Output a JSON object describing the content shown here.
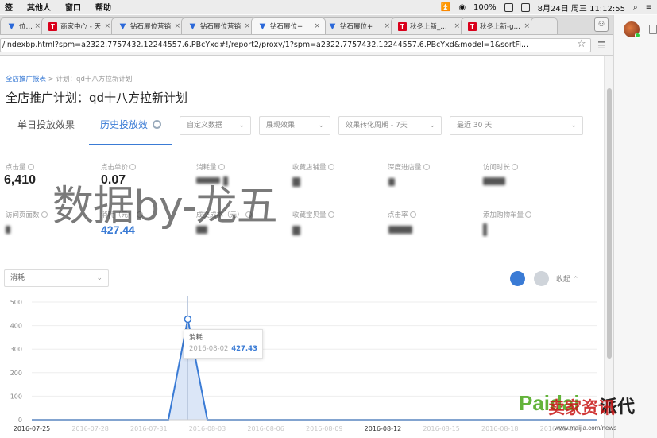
{
  "menubar": {
    "items": [
      "签",
      "其他人",
      "窗口",
      "帮助"
    ],
    "battery": "100%",
    "datetime": "8月24日 周三  11:12:55"
  },
  "browser": {
    "tabs": [
      {
        "label": "位营销",
        "icon": "diamond-icon"
      },
      {
        "label": "商家中心 - 天",
        "icon": "tmall-icon"
      },
      {
        "label": "钻石展位营销",
        "icon": "diamond-icon"
      },
      {
        "label": "钻石展位营销",
        "icon": "diamond-icon"
      },
      {
        "label": "钻石展位+",
        "icon": "diamond-icon",
        "active": true
      },
      {
        "label": "钻石展位+",
        "icon": "diamond-icon"
      },
      {
        "label": "秋冬上新_下拉",
        "icon": "tmall-icon"
      },
      {
        "label": "秋冬上新-girls",
        "icon": "tmall-icon"
      }
    ],
    "url": "/indexbp.html?spm=a2322.7757432.12244557.6.PBcYxd#!/report2/proxy/1?spm=a2322.7757432.12244557.6.PBcYxd&model=1&sortFi..."
  },
  "page": {
    "breadcrumb_root": "全店推广报表",
    "breadcrumb_sep": ">",
    "breadcrumb_current": "计划：qd十八方拉新计划",
    "title": "全店推广计划：qd十八方拉新计划",
    "tabs": [
      "单日投放效果",
      "历史投放效"
    ],
    "filters": [
      "自定义数据",
      "展现效果",
      "效果转化周期 - 7天",
      "最近 30 天"
    ],
    "metrics": [
      {
        "label": "点击量",
        "value": "6,410"
      },
      {
        "label": "点击单价",
        "value": "0.07"
      },
      {
        "label": "消耗量",
        "value": ""
      },
      {
        "label": "收藏店铺量",
        "value": ""
      },
      {
        "label": "深度进店量",
        "value": ""
      },
      {
        "label": "访问时长",
        "value": ""
      },
      {
        "label": "访问页面数",
        "value": ""
      },
      {
        "label": "消耗（元）",
        "value": "427.44"
      },
      {
        "label": "成交成本（元）",
        "value": ""
      },
      {
        "label": "收藏宝贝量",
        "value": ""
      },
      {
        "label": "点击率",
        "value": ""
      },
      {
        "label": "添加购物车量",
        "value": ""
      }
    ],
    "watermark": "数据by-龙五",
    "chart_selector": "消耗",
    "collapse_label": "收起"
  },
  "tooltip": {
    "name": "消耗",
    "date": "2016-08-02",
    "value": "427.43"
  },
  "chart_data": {
    "type": "area",
    "x": [
      "2016-07-25",
      "2016-07-26",
      "2016-07-27",
      "2016-07-28",
      "2016-07-29",
      "2016-07-30",
      "2016-07-31",
      "2016-08-01",
      "2016-08-02",
      "2016-08-03",
      "2016-08-04",
      "2016-08-05",
      "2016-08-06",
      "2016-08-07",
      "2016-08-08",
      "2016-08-09",
      "2016-08-10",
      "2016-08-11",
      "2016-08-12",
      "2016-08-13",
      "2016-08-14",
      "2016-08-15",
      "2016-08-16",
      "2016-08-17",
      "2016-08-18",
      "2016-08-19",
      "2016-08-20",
      "2016-08-21",
      "2016-08-22",
      "2016-08-23"
    ],
    "series": [
      {
        "name": "消耗",
        "values": [
          0,
          0,
          0,
          0,
          0,
          0,
          0,
          0,
          427.43,
          0,
          0,
          0,
          0,
          0,
          0,
          0,
          0,
          0,
          0,
          0,
          0,
          0,
          0,
          0,
          0,
          0,
          0,
          0,
          0,
          0
        ]
      }
    ],
    "yticks": [
      0,
      100,
      200,
      300,
      400,
      500
    ],
    "ylim": [
      0,
      500
    ],
    "xtick_labels": [
      "2016-07-25",
      "2016-07-28",
      "2016-07-31",
      "2016-08-03",
      "2016-08-06",
      "2016-08-09",
      "2016-08-12",
      "2016-08-15",
      "2016-08-18",
      "2016-08-21"
    ],
    "grid": true,
    "color": "#3a7bd5",
    "fill": "#dbe6f7"
  },
  "logos": {
    "paidai": "Paidai",
    "paidai_cn": "派代",
    "site_cn": "卖家资讯",
    "site_url": "www.maijia.com/news"
  }
}
